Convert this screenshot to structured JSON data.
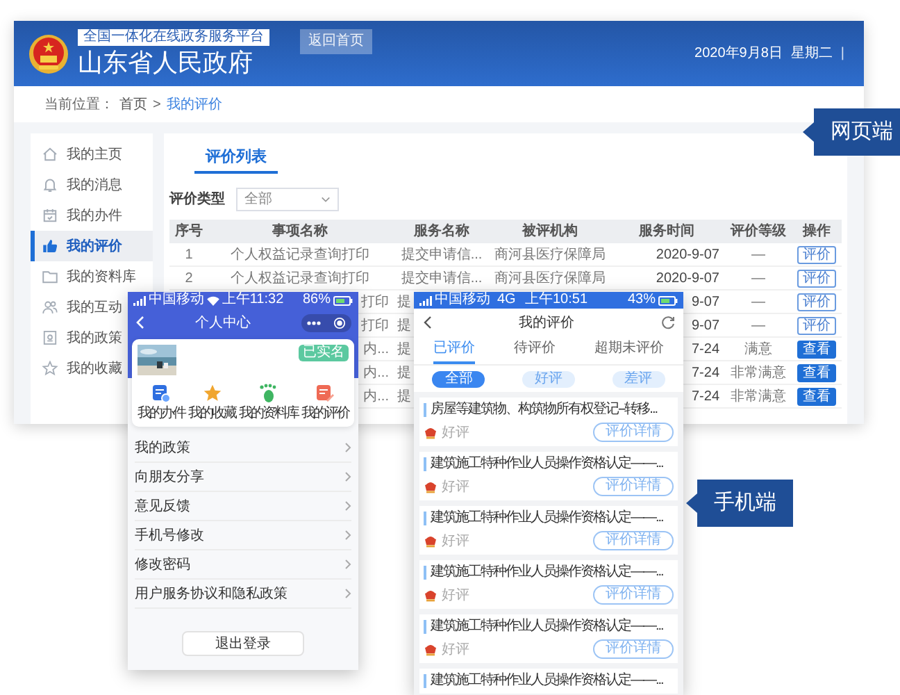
{
  "web_window": {
    "header": {
      "platform_badge": "全国一体化在线政务服务平台",
      "site_title": "山东省人民政府",
      "home_button": "返回首页",
      "date": "2020年9月8日",
      "weekday": "星期二",
      "divider": "|"
    },
    "breadcrumb": {
      "label": "当前位置：",
      "separator": ">",
      "items": [
        {
          "text": "首页",
          "selected": false
        },
        {
          "text": "我的评价",
          "selected": true
        }
      ]
    },
    "sidebar": {
      "items": [
        {
          "label": "我的主页",
          "selected": false
        },
        {
          "label": "我的消息",
          "selected": false
        },
        {
          "label": "我的办件",
          "selected": false
        },
        {
          "label": "我的评价",
          "selected": true
        },
        {
          "label": "我的资料库",
          "selected": false
        },
        {
          "label": "我的互动",
          "selected": false
        },
        {
          "label": "我的政策",
          "selected": false
        },
        {
          "label": "我的收藏",
          "selected": false
        }
      ]
    },
    "tabs": [
      {
        "label": "评价列表",
        "selected": true
      }
    ],
    "filter": {
      "label": "评价类型",
      "value": "全部"
    },
    "table": {
      "columns": [
        "序号",
        "事项名称",
        "服务名称",
        "被评机构",
        "服务时间",
        "评价等级",
        "操作"
      ],
      "rows": [
        {
          "kind": "full",
          "seq": "1",
          "item": "个人权益记录查询打印",
          "service": "提交申请信...",
          "org": "商河县医疗保障局",
          "time": "2020-9-07",
          "grade": "—",
          "action": {
            "label": "评价",
            "kind": "outline"
          }
        },
        {
          "kind": "full",
          "seq": "2",
          "item": "个人权益记录查询打印",
          "service": "提交申请信...",
          "org": "商河县医疗保障局",
          "time": "2020-9-07",
          "grade": "—",
          "action": {
            "label": "评价",
            "kind": "outline"
          }
        },
        {
          "kind": "covered",
          "item": "打印",
          "service": "提",
          "time": "9-07",
          "grade": "—",
          "action": {
            "label": "评价",
            "kind": "outline"
          }
        },
        {
          "kind": "covered",
          "item": "打印",
          "service": "提",
          "time": "9-07",
          "grade": "—",
          "action": {
            "label": "评价",
            "kind": "outline"
          }
        },
        {
          "kind": "covered",
          "item": "内...",
          "service": "提",
          "time": "7-24",
          "grade": "满意",
          "action": {
            "label": "查看",
            "kind": "filled"
          }
        },
        {
          "kind": "covered",
          "item": "内...",
          "service": "提",
          "time": "7-24",
          "grade": "非常满意",
          "action": {
            "label": "查看",
            "kind": "filled"
          }
        },
        {
          "kind": "covered",
          "item": "内...",
          "service": "提",
          "time": "7-24",
          "grade": "非常满意",
          "action": {
            "label": "查看",
            "kind": "filled"
          }
        }
      ]
    }
  },
  "left_phone": {
    "status_bar": {
      "carrier": "中国移动",
      "time": "上午11:32",
      "battery": "86%"
    },
    "title": "个人中心",
    "badge": "已实名",
    "shortcuts": [
      "我的办件",
      "我的收藏",
      "我的资料库",
      "我的评价"
    ],
    "menu": [
      "我的政策",
      "向朋友分享",
      "意见反馈",
      "手机号修改",
      "修改密码",
      "用户服务协议和隐私政策"
    ],
    "logout_button": "退出登录"
  },
  "right_phone": {
    "status_bar": {
      "carrier": "中国移动",
      "network": "4G",
      "time": "上午10:51",
      "battery": "43%"
    },
    "title": "我的评价",
    "tabs": [
      {
        "label": "已评价",
        "selected": true
      },
      {
        "label": "待评价",
        "selected": false
      },
      {
        "label": "超期未评价",
        "selected": false
      }
    ],
    "filters": [
      {
        "label": "全部",
        "selected": true
      },
      {
        "label": "好评",
        "selected": false
      },
      {
        "label": "差评",
        "selected": false
      }
    ],
    "cards": [
      {
        "title": "房屋等建筑物、构筑物所有权登记--转移...",
        "rating": "好评",
        "button": "评价详情"
      },
      {
        "title": "建筑施工特种作业人员操作资格认定——...",
        "rating": "好评",
        "button": "评价详情"
      },
      {
        "title": "建筑施工特种作业人员操作资格认定——...",
        "rating": "好评",
        "button": "评价详情"
      },
      {
        "title": "建筑施工特种作业人员操作资格认定——...",
        "rating": "好评",
        "button": "评价详情"
      },
      {
        "title": "建筑施工特种作业人员操作资格认定——...",
        "rating": "好评",
        "button": "评价详情"
      },
      {
        "title": "建筑施工特种作业人员操作资格认定——..."
      }
    ]
  },
  "callouts": [
    "网页端",
    "手机端"
  ]
}
